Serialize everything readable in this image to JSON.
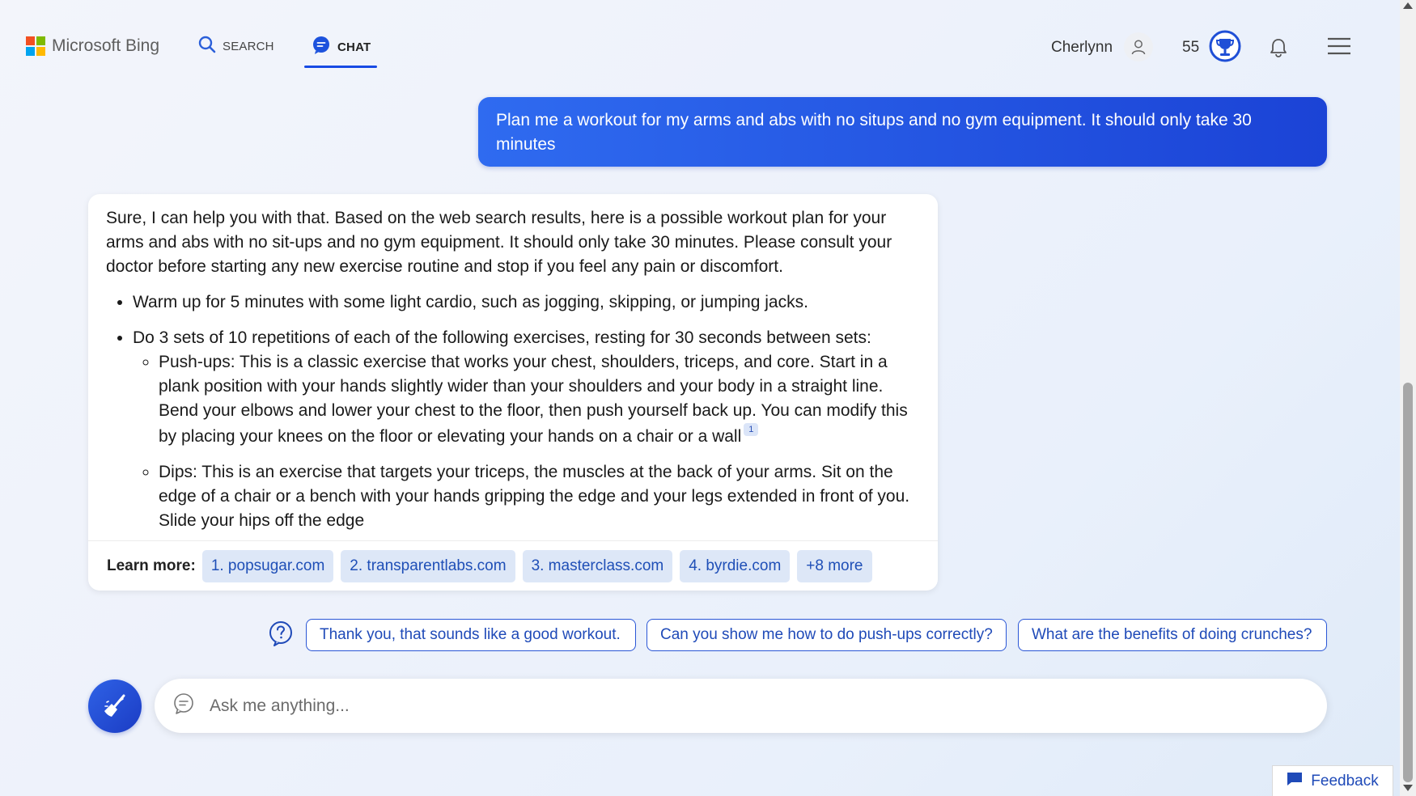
{
  "header": {
    "logo_text": "Microsoft Bing",
    "tabs": [
      {
        "label": "SEARCH",
        "icon": "search-icon"
      },
      {
        "label": "CHAT",
        "icon": "chat-icon",
        "active": true
      }
    ],
    "user_name": "Cherlynn",
    "points": "55"
  },
  "conversation": {
    "user_message": "Plan me a workout for my arms and abs with no situps and no gym equipment. It should only take 30 minutes",
    "bot": {
      "intro": "Sure, I can help you with that. Based on the web search results, here is a possible workout plan for your arms and abs with no sit-ups and no gym equipment. It should only take 30 minutes. Please consult your doctor before starting any new exercise routine and stop if you feel any pain or discomfort.",
      "bullet_1": "Warm up for 5 minutes with some light cardio, such as jogging, skipping, or jumping jacks.",
      "bullet_2": "Do 3 sets of 10 repetitions of each of the following exercises, resting for 30 seconds between sets:",
      "sub_1": "Push-ups: This is a classic exercise that works your chest, shoulders, triceps, and core. Start in a plank position with your hands slightly wider than your shoulders and your body in a straight line. Bend your elbows and lower your chest to the floor, then push yourself back up. You can modify this by placing your knees on the floor or elevating your hands on a chair or a wall",
      "sub_1_citation": "1",
      "sub_2": "Dips: This is an exercise that targets your triceps, the muscles at the back of your arms. Sit on the edge of a chair or a bench with your hands gripping the edge and your legs extended in front of you. Slide your hips off the edge"
    },
    "learn_more": {
      "label": "Learn more:",
      "sources": [
        "1. popsugar.com",
        "2. transparentlabs.com",
        "3. masterclass.com",
        "4. byrdie.com",
        "+8 more"
      ]
    }
  },
  "suggestions": [
    "Thank you, that sounds like a good workout.",
    "Can you show me how to do push-ups correctly?",
    "What are the benefits of doing crunches?"
  ],
  "input": {
    "placeholder": "Ask me anything...",
    "value": ""
  },
  "feedback_label": "Feedback",
  "colors": {
    "accent": "#174ae4",
    "user_bubble_start": "#2f6bf0",
    "user_bubble_end": "#1b43d6",
    "chip_bg": "#dde7f7",
    "chip_text": "#1f4fb7"
  }
}
